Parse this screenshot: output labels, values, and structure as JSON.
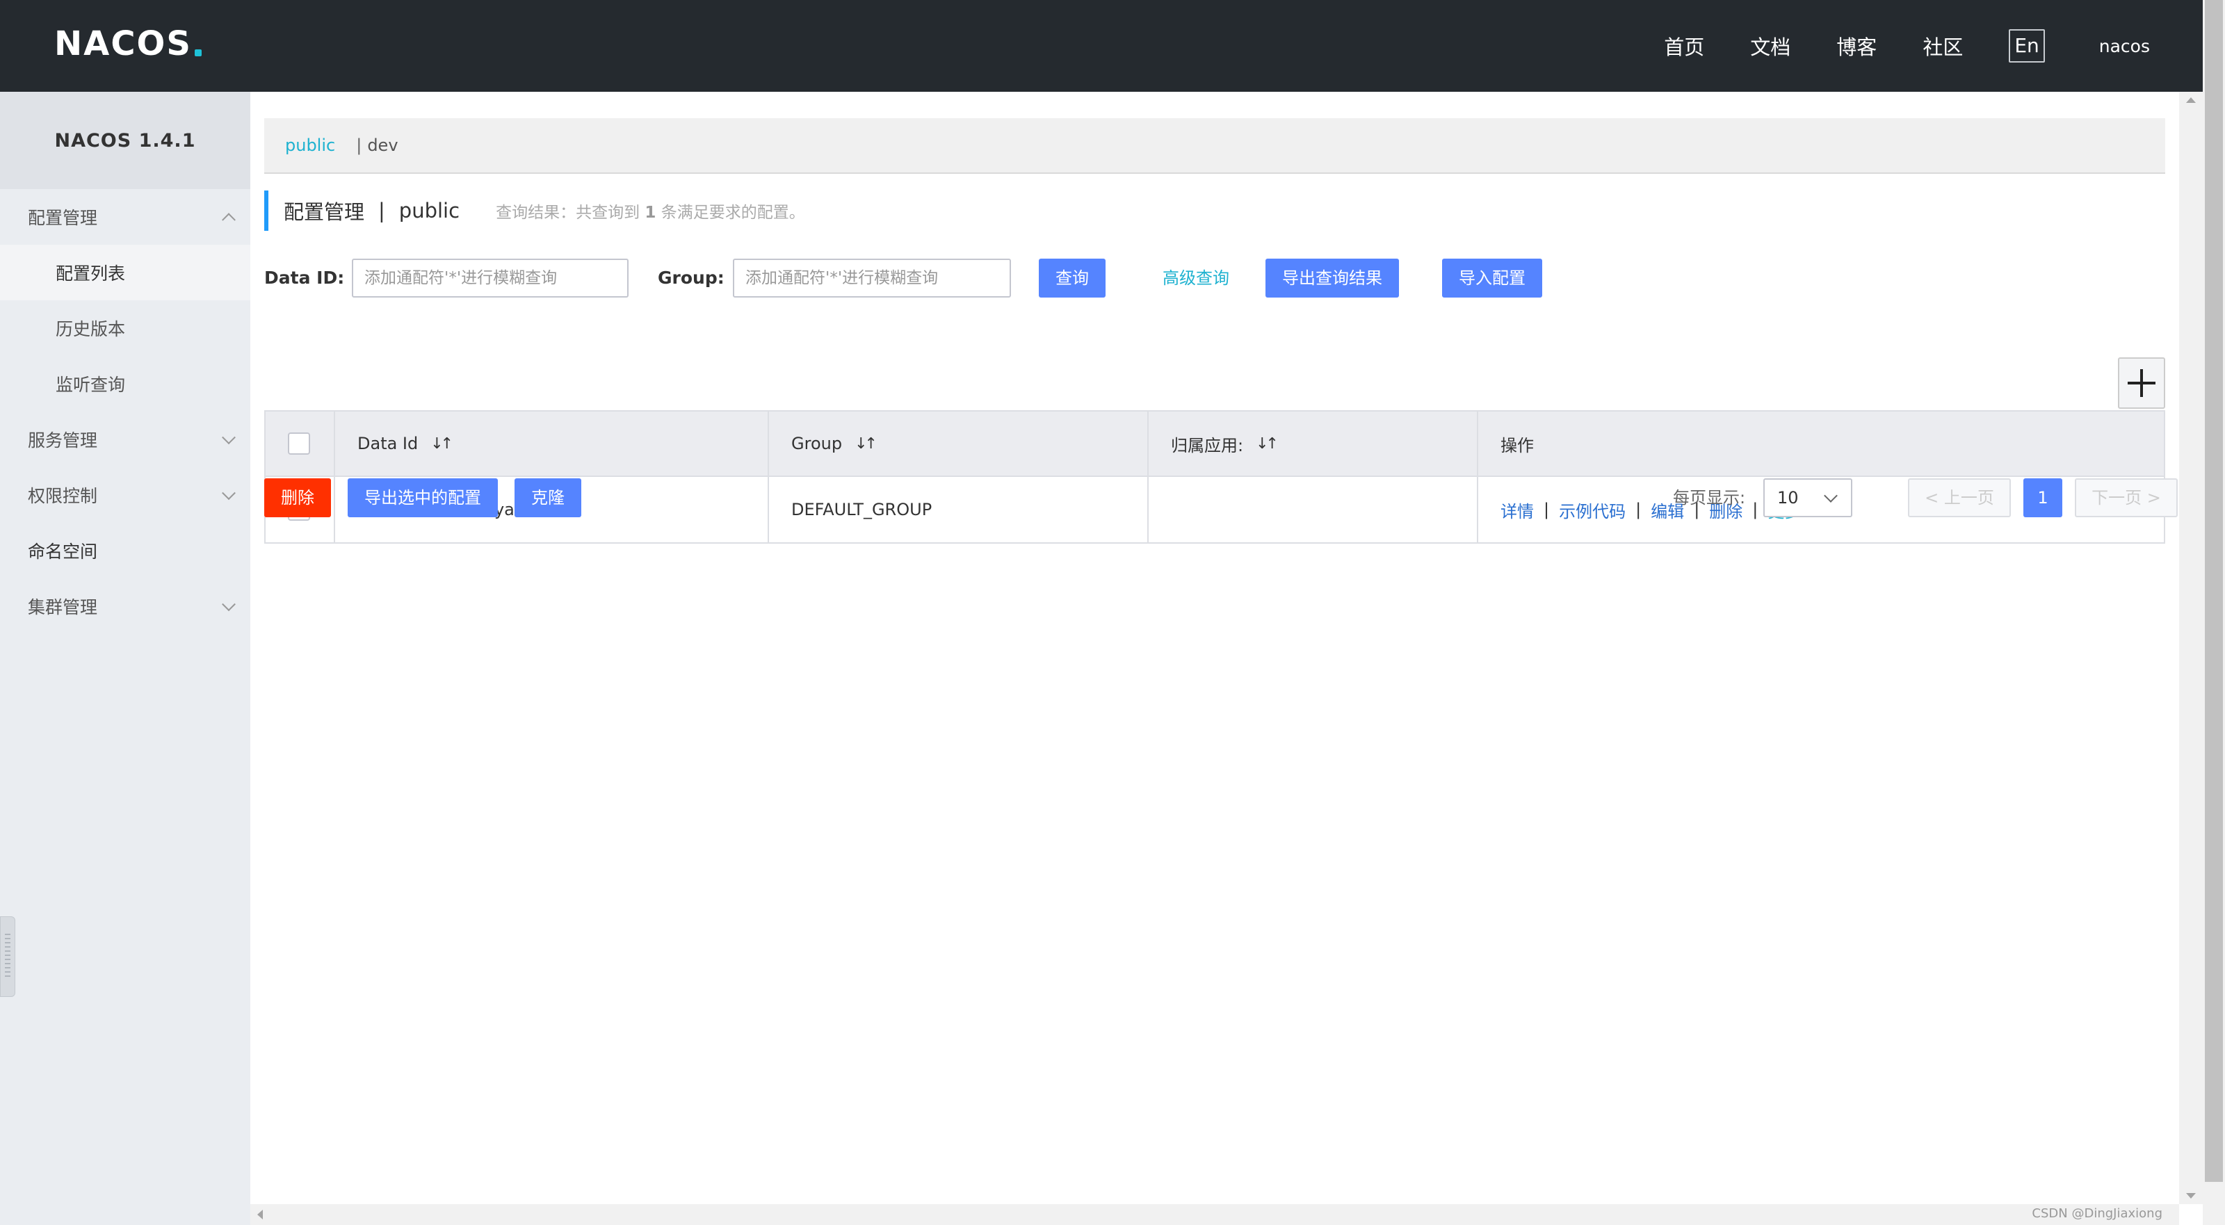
{
  "header": {
    "logo": "NACOS",
    "nav": [
      "首页",
      "文档",
      "博客",
      "社区"
    ],
    "lang": "En",
    "user": "nacos"
  },
  "sidebar": {
    "brand": "NACOS 1.4.1",
    "items": [
      {
        "label": "配置管理",
        "expanded": true
      },
      {
        "label": "配置列表"
      },
      {
        "label": "历史版本"
      },
      {
        "label": "监听查询"
      },
      {
        "label": "服务管理"
      },
      {
        "label": "权限控制"
      },
      {
        "label": "命名空间"
      },
      {
        "label": "集群管理"
      }
    ]
  },
  "namespace": {
    "current": "public",
    "separator": "|",
    "other": "dev"
  },
  "page": {
    "title": "配置管理",
    "separator": "|",
    "namespace": "public",
    "result_prefix": "查询结果：共查询到",
    "result_count": "1",
    "result_suffix": "条满足要求的配置。"
  },
  "filters": {
    "dataid_label": "Data ID:",
    "dataid_placeholder": "添加通配符'*'进行模糊查询",
    "group_label": "Group:",
    "group_placeholder": "添加通配符'*'进行模糊查询",
    "search_button": "查询",
    "advanced_link": "高级查询",
    "export_button": "导出查询结果",
    "import_button": "导入配置"
  },
  "table": {
    "headers": [
      "Data Id",
      "Group",
      "归属应用:",
      "操作"
    ],
    "sort_icon": "↓↑",
    "rows": [
      {
        "data_id": "userservice-dev.yaml",
        "group": "DEFAULT_GROUP",
        "app": "",
        "actions": [
          "详情",
          "示例代码",
          "编辑",
          "删除",
          "更多"
        ]
      }
    ]
  },
  "bottom": {
    "delete_button": "删除",
    "export_selected_button": "导出选中的配置",
    "clone_button": "克隆",
    "per_page_label": "每页显示:",
    "per_page_value": "10",
    "prev": "< 上一页",
    "current_page": "1",
    "next": "下一页 >"
  },
  "watermark": "CSDN @DingJiaxiong",
  "colors": {
    "header_bg": "#252a2f",
    "primary": "#5584ff",
    "danger": "#ff3000",
    "link": "#1fb2d0",
    "accent_bar": "#209bfa"
  }
}
